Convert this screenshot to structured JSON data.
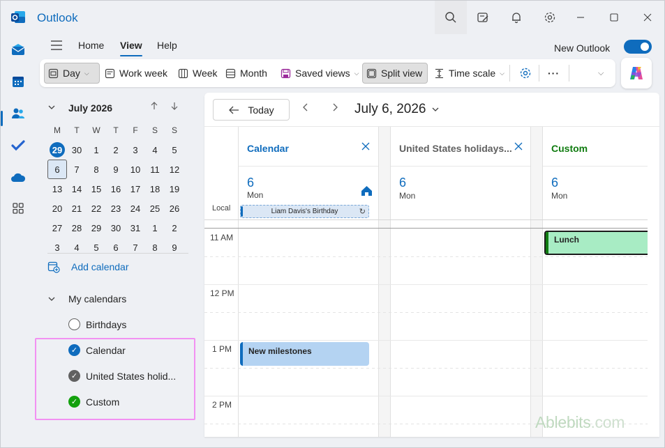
{
  "app": {
    "title": "Outlook"
  },
  "menu": {
    "tabs": [
      "Home",
      "View",
      "Help"
    ],
    "active": "View"
  },
  "new_outlook": {
    "label": "New Outlook",
    "enabled": true
  },
  "ribbon": {
    "day": "Day",
    "work_week": "Work week",
    "week": "Week",
    "month": "Month",
    "saved_views": "Saved views",
    "split_view": "Split view",
    "time_scale": "Time scale",
    "more": "···"
  },
  "mini_calendar": {
    "month_label": "July 2026",
    "weekdays": [
      "M",
      "T",
      "W",
      "T",
      "F",
      "S",
      "S"
    ],
    "weeks": [
      [
        "29",
        "30",
        "1",
        "2",
        "3",
        "4",
        "5"
      ],
      [
        "6",
        "7",
        "8",
        "9",
        "10",
        "11",
        "12"
      ],
      [
        "13",
        "14",
        "15",
        "16",
        "17",
        "18",
        "19"
      ],
      [
        "20",
        "21",
        "22",
        "23",
        "24",
        "25",
        "26"
      ],
      [
        "27",
        "28",
        "29",
        "30",
        "31",
        "1",
        "2"
      ],
      [
        "3",
        "4",
        "5",
        "6",
        "7",
        "8",
        "9"
      ]
    ],
    "today": "29",
    "selected": "6"
  },
  "sidebar": {
    "add_calendar": "Add calendar",
    "my_calendars": "My calendars",
    "calendars": [
      {
        "name": "Birthdays",
        "checked": false,
        "color": "#ffffff"
      },
      {
        "name": "Calendar",
        "checked": true,
        "color": "#0f6cbd"
      },
      {
        "name": "United States holid...",
        "checked": true,
        "color": "#616161"
      },
      {
        "name": "Custom",
        "checked": true,
        "color": "#13a10e"
      }
    ]
  },
  "main": {
    "today_button": "Today",
    "date_title": "July 6, 2026",
    "local_label": "Local",
    "columns": [
      {
        "title": "Calendar",
        "color": "#0f6cbd",
        "day_num": "6",
        "day_name": "Mon",
        "closable": true
      },
      {
        "title": "United States holidays...",
        "color": "#616161",
        "day_num": "6",
        "day_name": "Mon",
        "closable": true
      },
      {
        "title": "Custom",
        "color": "#107c10",
        "day_num": "6",
        "day_name": "Mon",
        "closable": false
      }
    ],
    "time_labels": [
      "11 AM",
      "12 PM",
      "1 PM",
      "2 PM"
    ],
    "all_day_event": "Liam Davis's Birthday",
    "events": [
      {
        "title": "New milestones",
        "calendar": "Calendar",
        "bg": "#b4d3f2",
        "bar": "#0f6cbd"
      },
      {
        "title": "Lunch",
        "calendar": "Custom",
        "bg": "#a8ecc4",
        "bar": "#107c10"
      }
    ]
  },
  "watermark": {
    "brand": "Ablebits",
    "suffix": ".com"
  }
}
